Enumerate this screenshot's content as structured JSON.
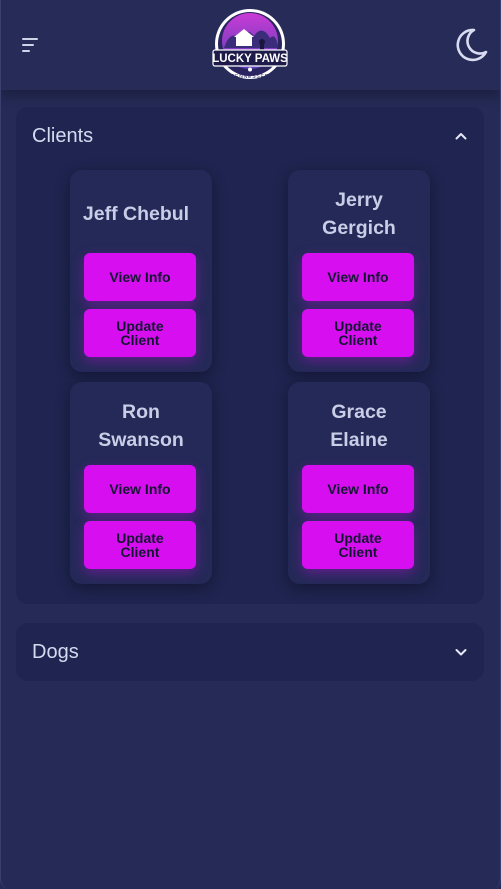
{
  "header": {
    "logo": {
      "brand_text": "LUCKY PAWS",
      "sub_text": "TENNESSEE"
    }
  },
  "sections": {
    "clients": {
      "title": "Clients",
      "expanded": true,
      "cards": [
        {
          "name": "Jeff Chebul",
          "view_label": "View Info",
          "update_label": "Update Client"
        },
        {
          "name": "Jerry Gergich",
          "view_label": "View Info",
          "update_label": "Update Client"
        },
        {
          "name": "Ron Swanson",
          "view_label": "View Info",
          "update_label": "Update Client"
        },
        {
          "name": "Grace Elaine",
          "view_label": "View Info",
          "update_label": "Update Client"
        }
      ]
    },
    "dogs": {
      "title": "Dogs",
      "expanded": false
    }
  },
  "colors": {
    "background": "#252a56",
    "panel": "#1f2450",
    "card": "#242958",
    "accent": "#d70ff0"
  }
}
